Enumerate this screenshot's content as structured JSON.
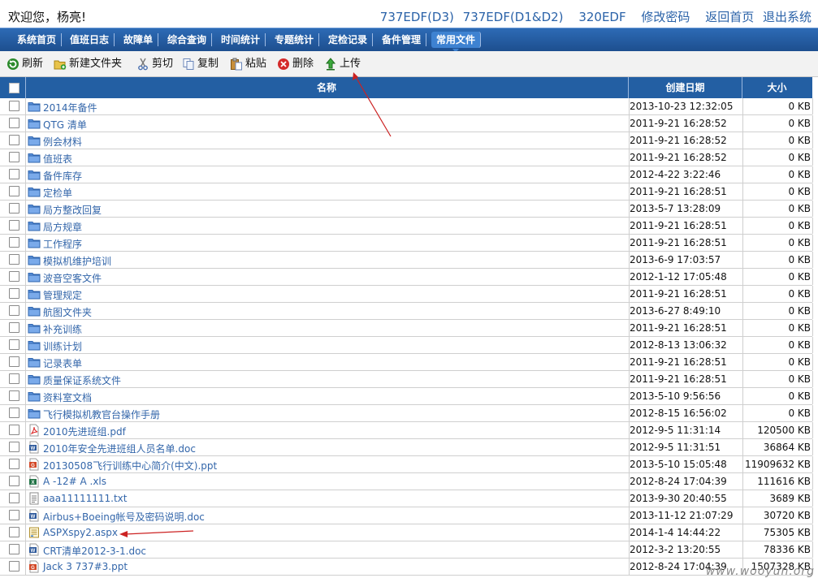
{
  "header": {
    "welcome": "欢迎您，杨亮!",
    "links": [
      "737EDF(D3)",
      "737EDF(D1&D2)",
      "320EDF",
      "修改密码",
      "返回首页",
      "退出系统"
    ]
  },
  "nav": {
    "items": [
      "系统首页",
      "值班日志",
      "故障单",
      "综合查询",
      "时间统计",
      "专题统计",
      "定检记录",
      "备件管理",
      "常用文件"
    ],
    "active": "常用文件"
  },
  "toolbar": {
    "refresh": "刷新",
    "new_folder": "新建文件夹",
    "cut": "剪切",
    "copy": "复制",
    "paste": "粘贴",
    "delete": "删除",
    "upload": "上传"
  },
  "table": {
    "headers": {
      "name": "名称",
      "date": "创建日期",
      "size": "大小"
    },
    "rows": [
      {
        "name": "2014年备件",
        "date": "2013-10-23 12:32:05",
        "size": "0 KB",
        "icon": "folder-icon"
      },
      {
        "name": "QTG 清单",
        "date": "2011-9-21 16:28:52",
        "size": "0 KB",
        "icon": "folder-icon"
      },
      {
        "name": "例会材料",
        "date": "2011-9-21 16:28:52",
        "size": "0 KB",
        "icon": "folder-icon"
      },
      {
        "name": "值班表",
        "date": "2011-9-21 16:28:52",
        "size": "0 KB",
        "icon": "folder-icon"
      },
      {
        "name": "备件库存",
        "date": "2012-4-22 3:22:46",
        "size": "0 KB",
        "icon": "folder-icon"
      },
      {
        "name": "定检单",
        "date": "2011-9-21 16:28:51",
        "size": "0 KB",
        "icon": "folder-icon"
      },
      {
        "name": "局方整改回复",
        "date": "2013-5-7 13:28:09",
        "size": "0 KB",
        "icon": "folder-icon"
      },
      {
        "name": "局方规章",
        "date": "2011-9-21 16:28:51",
        "size": "0 KB",
        "icon": "folder-icon"
      },
      {
        "name": "工作程序",
        "date": "2011-9-21 16:28:51",
        "size": "0 KB",
        "icon": "folder-icon"
      },
      {
        "name": "模拟机维护培训",
        "date": "2013-6-9 17:03:57",
        "size": "0 KB",
        "icon": "folder-icon"
      },
      {
        "name": "波音空客文件",
        "date": "2012-1-12 17:05:48",
        "size": "0 KB",
        "icon": "folder-icon"
      },
      {
        "name": "管理规定",
        "date": "2011-9-21 16:28:51",
        "size": "0 KB",
        "icon": "folder-icon"
      },
      {
        "name": "航图文件夹",
        "date": "2013-6-27 8:49:10",
        "size": "0 KB",
        "icon": "folder-icon"
      },
      {
        "name": "补充训练",
        "date": "2011-9-21 16:28:51",
        "size": "0 KB",
        "icon": "folder-icon"
      },
      {
        "name": "训练计划",
        "date": "2012-8-13 13:06:32",
        "size": "0 KB",
        "icon": "folder-icon"
      },
      {
        "name": "记录表单",
        "date": "2011-9-21 16:28:51",
        "size": "0 KB",
        "icon": "folder-icon"
      },
      {
        "name": "质量保证系统文件",
        "date": "2011-9-21 16:28:51",
        "size": "0 KB",
        "icon": "folder-icon"
      },
      {
        "name": "资料室文档",
        "date": "2013-5-10 9:56:56",
        "size": "0 KB",
        "icon": "folder-icon"
      },
      {
        "name": "飞行模拟机教官台操作手册",
        "date": "2012-8-15 16:56:02",
        "size": "0 KB",
        "icon": "folder-icon"
      },
      {
        "name": "2010先进班组.pdf",
        "date": "2012-9-5 11:31:14",
        "size": "120500 KB",
        "icon": "pdf-icon"
      },
      {
        "name": "2010年安全先进班组人员名单.doc",
        "date": "2012-9-5 11:31:51",
        "size": "36864 KB",
        "icon": "doc-icon"
      },
      {
        "name": "20130508飞行训练中心简介(中文).ppt",
        "date": "2013-5-10 15:05:48",
        "size": "11909632 KB",
        "icon": "ppt-icon"
      },
      {
        "name": "A -12# A .xls",
        "date": "2012-8-24 17:04:39",
        "size": "111616 KB",
        "icon": "xls-icon"
      },
      {
        "name": "aaa11111111.txt",
        "date": "2013-9-30 20:40:55",
        "size": "3689 KB",
        "icon": "txt-icon"
      },
      {
        "name": "Airbus+Boeing帐号及密码说明.doc",
        "date": "2013-11-12 21:07:29",
        "size": "30720 KB",
        "icon": "doc-icon"
      },
      {
        "name": "ASPXspy2.aspx",
        "date": "2014-1-4 14:44:22",
        "size": "75305 KB",
        "icon": "aspx-icon"
      },
      {
        "name": "CRT清单2012-3-1.doc",
        "date": "2012-3-2 13:20:55",
        "size": "78336 KB",
        "icon": "doc-icon"
      },
      {
        "name": "Jack 3 737#3.ppt",
        "date": "2012-8-24 17:04:39",
        "size": "1507328 KB",
        "icon": "ppt-icon"
      }
    ]
  },
  "watermark": "www.wooyun.org",
  "colors": {
    "nav_bg": "#235fa3",
    "link": "#3366aa",
    "arrow": "#cc2222"
  }
}
